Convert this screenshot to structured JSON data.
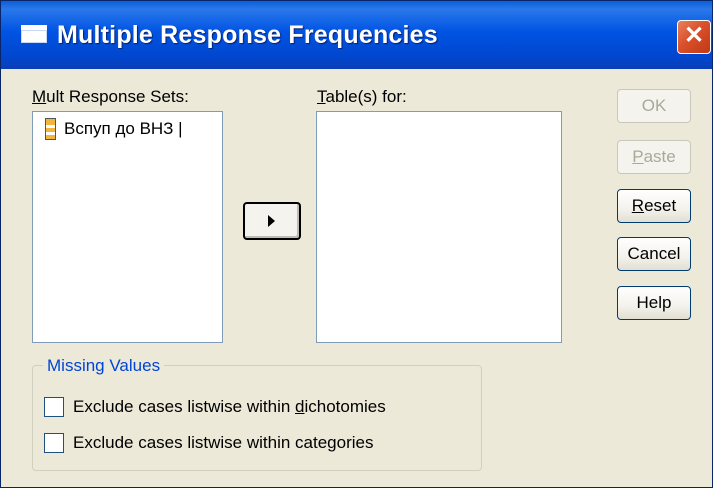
{
  "window": {
    "title": "Multiple Response Frequencies",
    "close_glyph": "✕"
  },
  "mult_response_sets": {
    "label_mnemonic": "M",
    "label_rest": "ult Response Sets:",
    "items": [
      {
        "label": "Вспуп до ВНЗ |",
        "icon": "multiple-response-set-icon"
      }
    ]
  },
  "tables_for": {
    "label_mnemonic": "T",
    "label_rest": "able(s) for:",
    "items": []
  },
  "move_button": {
    "icon": "right-arrow-icon"
  },
  "buttons": {
    "ok": {
      "label": "OK",
      "enabled": false
    },
    "paste": {
      "label_mnemonic": "P",
      "label_rest": "aste",
      "enabled": false
    },
    "reset": {
      "label_mnemonic": "R",
      "label_rest": "eset",
      "enabled": true
    },
    "cancel": {
      "label": "Cancel",
      "enabled": true
    },
    "help": {
      "label": "Help",
      "enabled": true
    }
  },
  "missing_values": {
    "legend": "Missing Values",
    "options": [
      {
        "prefix": "Exclude cases listwise within ",
        "mnemonic": "d",
        "suffix": "ichotomies",
        "checked": false
      },
      {
        "prefix": "Exclude cases listwise within ",
        "mnemonic": "",
        "suffix": "categories",
        "checked": false
      }
    ]
  },
  "colors": {
    "titlebar": "#0054e3",
    "dialog_bg": "#ece9d8",
    "group_legend": "#0046d5",
    "close_button": "#d9502c"
  }
}
